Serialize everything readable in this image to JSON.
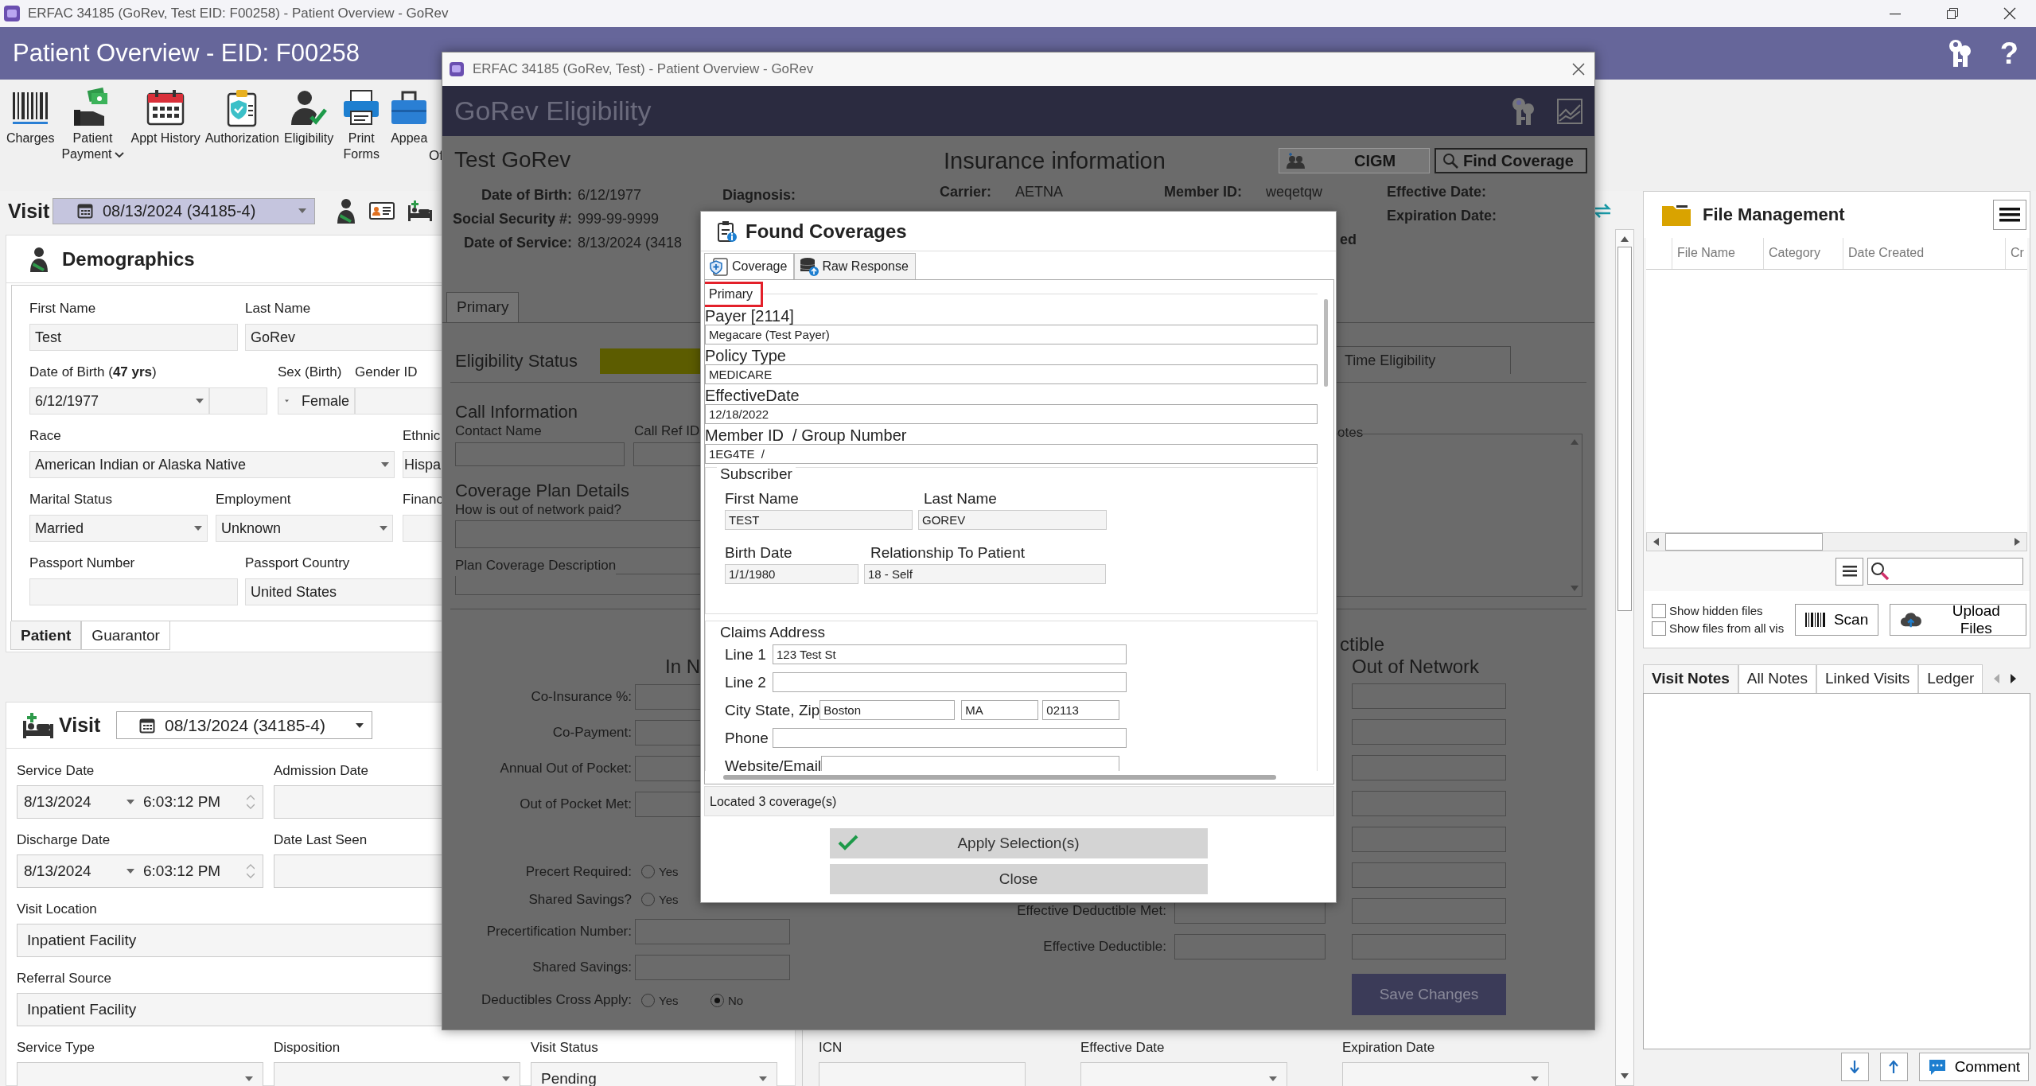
{
  "window": {
    "title": "ERFAC 34185 (GoRev, Test EID: F00258) - Patient Overview - GoRev"
  },
  "header": {
    "title": "Patient Overview - EID: F00258",
    "help": "?"
  },
  "toolbar": {
    "items": [
      {
        "label": "Charges",
        "kind": "barcode",
        "dropdown": false
      },
      {
        "label": "Patient Payment",
        "kind": "payment",
        "dropdown": true
      },
      {
        "label": "Appt History",
        "kind": "calendar",
        "dropdown": false
      },
      {
        "label": "Authorization",
        "kind": "clipboard",
        "dropdown": false
      },
      {
        "label": "Eligibility",
        "kind": "person-check",
        "dropdown": false
      },
      {
        "label": "Print Forms",
        "kind": "printer",
        "dropdown": false
      },
      {
        "label": "Appea",
        "kind": "briefcase",
        "dropdown": false
      }
    ],
    "group_label": "Of"
  },
  "visit_bar": {
    "label": "Visit",
    "value": "08/13/2024 (34185-4)"
  },
  "demographics": {
    "title": "Demographics",
    "rows": [
      [
        {
          "label": "First Name",
          "value": "Test",
          "kind": "text"
        },
        {
          "label": "Last Name",
          "value": "GoRev",
          "kind": "text"
        }
      ],
      [
        {
          "label": "Date of Birth (**47 yrs**)",
          "value": "6/12/1977",
          "kind": "dropdown"
        },
        {
          "kind": "text"
        },
        {
          "label": "Sex (Birth)",
          "value": "Female",
          "kind": "dropdown-left"
        },
        {
          "label": "Gender ID",
          "kind": "text"
        }
      ],
      [
        {
          "label": "Race",
          "value": "American Indian or Alaska Native",
          "kind": "dropdown"
        },
        {
          "label": "Ethnic",
          "value": "Hispa",
          "kind": "text"
        }
      ],
      [
        {
          "label": "Marital Status",
          "value": "Married",
          "kind": "dropdown"
        },
        {
          "label": "Employment",
          "value": "Unknown",
          "kind": "dropdown"
        },
        {
          "label": "Financ",
          "kind": "text"
        }
      ],
      [
        {
          "label": "Passport Number",
          "kind": "text"
        },
        {
          "label": "Passport Country",
          "value": "United States",
          "kind": "text"
        }
      ]
    ],
    "tabs": [
      {
        "label": "Patient",
        "selected": true
      },
      {
        "label": "Guarantor",
        "selected": false
      }
    ]
  },
  "visit": {
    "title": "Visit",
    "value": "08/13/2024 (34185-4)",
    "rows": [
      [
        {
          "label": "Service Date",
          "kind": "datetime",
          "date": "8/13/2024",
          "time": "6:03:12 PM"
        },
        {
          "label": "Admission Date",
          "kind": "text"
        }
      ],
      [
        {
          "label": "Discharge Date",
          "kind": "datetime",
          "date": "8/13/2024",
          "time": "6:03:12 PM"
        },
        {
          "label": "Date Last Seen",
          "kind": "text"
        }
      ],
      [
        {
          "label": "Visit Location",
          "kind": "text",
          "value": "Inpatient Facility"
        }
      ],
      [
        {
          "label": "Referral Source",
          "kind": "text",
          "value": "Inpatient Facility"
        }
      ],
      [
        {
          "label": "Service Type",
          "kind": "dropdown"
        },
        {
          "label": "Disposition",
          "kind": "dropdown"
        },
        {
          "label": "Visit Status",
          "kind": "dropdown",
          "value": "Pending"
        }
      ]
    ]
  },
  "claim": {
    "fields": [
      {
        "label": "ICN",
        "kind": "text"
      },
      {
        "label": "Effective Date",
        "kind": "dropdown"
      },
      {
        "label": "Expiration Date",
        "kind": "dropdown"
      }
    ]
  },
  "file_management": {
    "title": "File Management",
    "columns": [
      "File Name",
      "Category",
      "Date Created",
      "Cr"
    ],
    "options": [
      {
        "label": "Show hidden files",
        "checked": false
      },
      {
        "label": "Show files from all vis",
        "checked": false
      }
    ],
    "buttons": [
      {
        "label": "Scan",
        "kind": "barcode"
      },
      {
        "label": "Upload Files",
        "kind": "upload"
      }
    ]
  },
  "notes": {
    "tabs": [
      {
        "label": "Visit Notes",
        "selected": true
      },
      {
        "label": "All Notes",
        "selected": false
      },
      {
        "label": "Linked Visits",
        "selected": false
      },
      {
        "label": "Ledger",
        "selected": false
      }
    ],
    "buttons": [
      {
        "kind": "down"
      },
      {
        "kind": "up"
      },
      {
        "kind": "comment",
        "label": "Comment"
      }
    ]
  },
  "eligibility_window": {
    "title": "ERFAC 34185 (GoRev, Test) - Patient Overview - GoRev",
    "heading": "GoRev Eligibility",
    "patient": {
      "name": "Test GoRev",
      "details": [
        {
          "label": "Date of Birth:",
          "value": "6/12/1977"
        },
        {
          "label": "Social Security #:",
          "value": "999-99-9999"
        },
        {
          "label": "Date of Service:",
          "value": "8/13/2024 (3418"
        }
      ],
      "diagnosis_label": "Diagnosis:"
    },
    "insurance": {
      "title": "Insurance information",
      "buttons": [
        {
          "label": "CIGM",
          "kind": "people"
        },
        {
          "label": "Find Coverage",
          "kind": "search"
        }
      ],
      "carrier_label": "Carrier:",
      "carrier": "AETNA",
      "member_id_label": "Member ID:",
      "member_id": "weqetqw",
      "effective_label": "Effective Date:",
      "expiration_label": "Expiration Date:",
      "column_4": "ed"
    },
    "tabs": [
      {
        "label": "Primary",
        "selected": true
      }
    ],
    "eligibility_status_label": "Eligibility Status",
    "time_eligibility": "Time Eligibility",
    "call_information": {
      "title": "Call Information",
      "contact_label": "Contact Name",
      "call_ref_label": "Call Ref ID"
    },
    "notes_label": "otes",
    "coverage_plan": {
      "title": "Coverage Plan Details",
      "question": "How is out of network paid?",
      "description_label": "Plan Coverage Description"
    },
    "in_network": {
      "heading": "In N",
      "rows": [
        "Co-Insurance %:",
        "Co-Payment:",
        "Annual Out of Pocket:",
        "Out of Pocket Met:"
      ]
    },
    "deductible_heading": "ctible",
    "out_of_network_heading": "Out of Network",
    "radios": [
      {
        "label": "Precert Required:",
        "options": [
          {
            "label": "Yes",
            "selected": false
          }
        ]
      },
      {
        "label": "Shared Savings?",
        "options": [
          {
            "label": "Yes",
            "selected": false
          }
        ]
      }
    ],
    "inputs": [
      "Precertification Number:",
      "Shared Savings:"
    ],
    "cross_apply": {
      "label": "Deductibles Cross Apply:",
      "options": [
        {
          "label": "Yes",
          "selected": false
        },
        {
          "label": "No",
          "selected": true
        }
      ]
    },
    "effective_rows": [
      "Effective Deductible Met:",
      "Effective Deductible:"
    ],
    "save_button": "Save Changes"
  },
  "found_coverages": {
    "title": "Found Coverages",
    "tabs": [
      {
        "label": "Coverage",
        "selected": true,
        "kind": "shield"
      },
      {
        "label": "Raw Response",
        "selected": false,
        "kind": "database"
      }
    ],
    "group": "Primary",
    "highlighted": true,
    "fields": [
      {
        "label": "Payer [2114]",
        "value": "Megacare (Test Payer)"
      },
      {
        "label": "Policy Type",
        "value": "MEDICARE"
      },
      {
        "label": "EffectiveDate",
        "value": "12/18/2022"
      },
      {
        "label": "Member ID  / Group Number",
        "value": "1EG4TE  /"
      }
    ],
    "subscriber": {
      "title": "Subscriber",
      "fields": [
        {
          "label": "First Name",
          "value": "TEST"
        },
        {
          "label": "Last Name",
          "value": "GOREV"
        },
        {
          "label": "Birth Date",
          "value": "1/1/1980"
        },
        {
          "label": "Relationship To Patient",
          "value": "18 - Self"
        }
      ]
    },
    "claims_address": {
      "title": "Claims Address",
      "line1_label": "Line 1",
      "line1": "123 Test St",
      "line2_label": "Line 2",
      "city_label": "City State, Zip",
      "city": "Boston",
      "state": "MA",
      "zip": "02113",
      "phone_label": "Phone",
      "website_label": "Website/Email"
    },
    "status": "Located 3 coverage(s)",
    "buttons": [
      {
        "label": "Apply Selection(s)",
        "kind": "apply"
      },
      {
        "label": "Close",
        "kind": "plain"
      }
    ]
  }
}
